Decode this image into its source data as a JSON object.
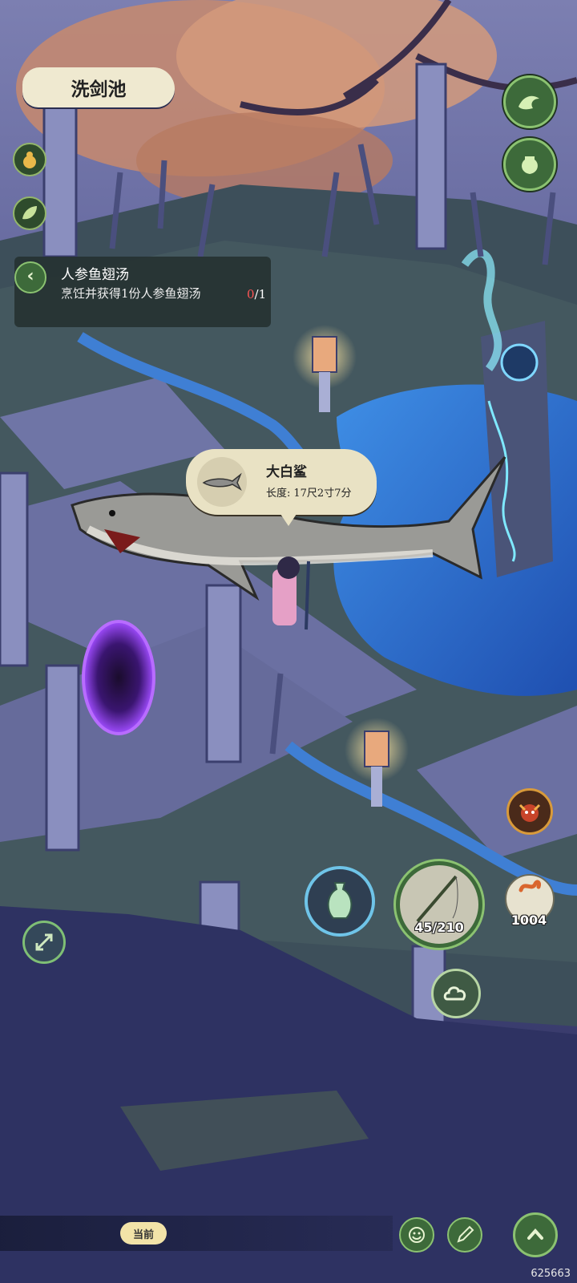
{
  "location": {
    "name": "洗剑池"
  },
  "quest": {
    "title": "人参鱼翅汤",
    "description": "烹饪并获得1份人参鱼翅汤",
    "progress_current": "0",
    "progress_total": "/1"
  },
  "catch_popup": {
    "fish_name": "大白鲨",
    "length_label": "长度:",
    "length_value": "17尺2寸7分"
  },
  "hud": {
    "stamina": "45/210",
    "bait_count": "1004",
    "chat_channel": "当前",
    "watermark": "625663"
  },
  "colors": {
    "accent_green": "#8bc271",
    "panel_bg": "#24302e",
    "popup_bg": "#e9e2c4",
    "progress_zero": "#ff5555"
  },
  "icons": {
    "left_column": [
      "gourd-icon",
      "leaf-icon"
    ],
    "right_column": [
      "wave-icon",
      "jar-icon"
    ],
    "actions": [
      "vase-icon",
      "fishing-rod-icon",
      "worm-bait-icon",
      "cloud-icon",
      "demon-mask-icon"
    ],
    "bottom": [
      "expand-icon",
      "emoji-icon",
      "pen-icon",
      "chevron-up-icon"
    ]
  }
}
